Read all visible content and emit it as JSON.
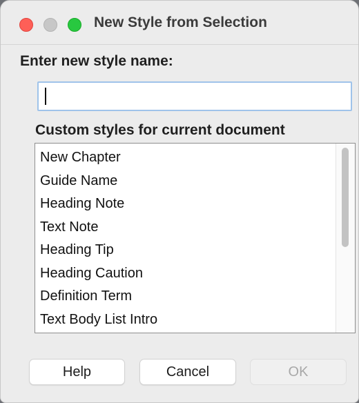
{
  "window": {
    "title": "New Style from Selection"
  },
  "form": {
    "name_label": "Enter new style name:",
    "name_value": "",
    "list_label": "Custom styles for current document"
  },
  "styles": [
    "New Chapter",
    "Guide Name",
    "Heading Note",
    "Text Note",
    "Heading Tip",
    "Heading Caution",
    "Definition Term",
    "Text Body List Intro"
  ],
  "buttons": {
    "help": "Help",
    "cancel": "Cancel",
    "ok": "OK",
    "ok_enabled": false
  },
  "colors": {
    "close": "#fe5f57",
    "minimize": "#c7c7c7",
    "zoom": "#28c840",
    "input_focus_border": "#9fc3ea"
  }
}
